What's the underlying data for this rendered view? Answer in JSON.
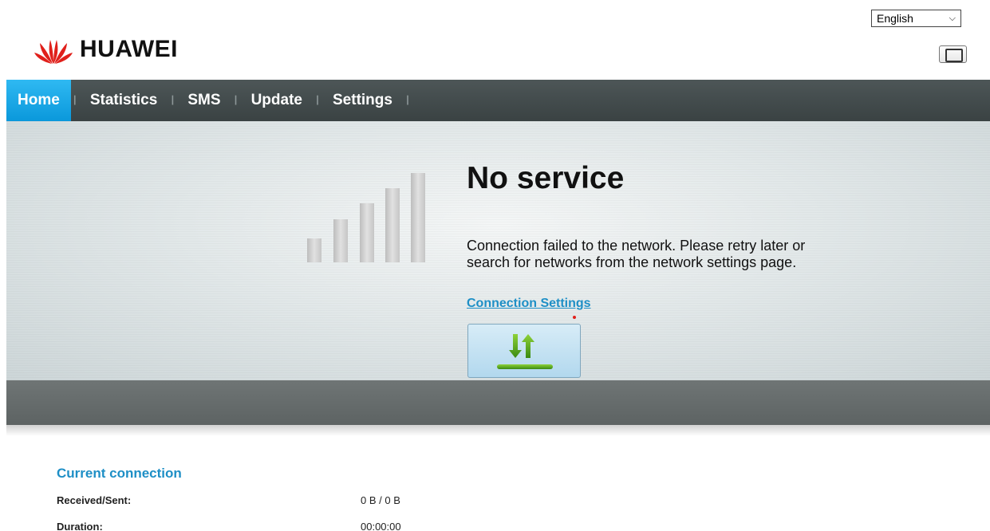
{
  "header": {
    "brand": "HUAWEI",
    "language": {
      "selected": "English"
    }
  },
  "nav": {
    "items": [
      {
        "label": "Home",
        "active": true
      },
      {
        "label": "Statistics",
        "active": false
      },
      {
        "label": "SMS",
        "active": false
      },
      {
        "label": "Update",
        "active": false
      },
      {
        "label": "Settings",
        "active": false
      }
    ]
  },
  "status": {
    "title": "No service",
    "message": "Connection failed to the network. Please retry later or search for networks from the network settings page.",
    "link": "Connection Settings",
    "signal_bars_active": 0,
    "signal_bars_total": 5
  },
  "connection": {
    "title": "Current connection",
    "rows": [
      {
        "label": "Received/Sent:",
        "value": "0 B /  0 B"
      },
      {
        "label": "Duration:",
        "value": "00:00:00"
      }
    ]
  },
  "colors": {
    "accent": "#1e8fc6",
    "nav_active": "#0a98db",
    "brand_red": "#e0201b"
  }
}
